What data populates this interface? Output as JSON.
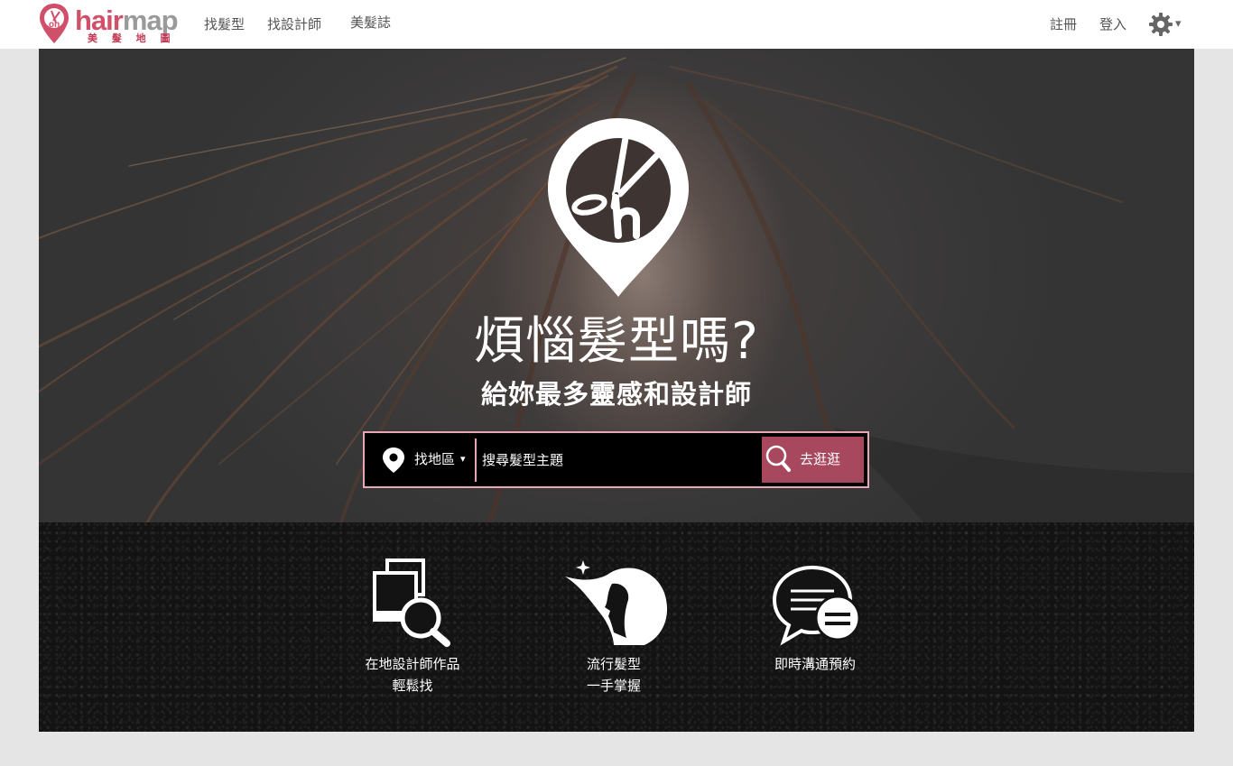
{
  "header": {
    "logo": {
      "word_a": "hair",
      "word_b": "map",
      "subtitle": "美 髮 地 圖"
    },
    "nav": [
      "找髮型",
      "找設計師",
      "美髮誌"
    ],
    "register": "註冊",
    "login": "登入",
    "settings_caret": "▾"
  },
  "hero": {
    "title": "煩惱髮型嗎?",
    "subtitle": "給妳最多靈感和設計師"
  },
  "search": {
    "location_label": "找地區",
    "location_caret": "▾",
    "placeholder": "搜尋髮型主題",
    "button_label": "去逛逛"
  },
  "features": [
    {
      "line1": "在地設計師作品",
      "line2": "輕鬆找",
      "icon": "gallery-search-icon"
    },
    {
      "line1": "流行髮型",
      "line2": "一手掌握",
      "icon": "hair-profile-icon"
    },
    {
      "line1": "即時溝通預約",
      "line2": "",
      "icon": "chat-bubbles-icon"
    }
  ],
  "colors": {
    "brand": "#d0506a",
    "accent_button": "#a8485e",
    "search_border": "#e8a6b8"
  }
}
